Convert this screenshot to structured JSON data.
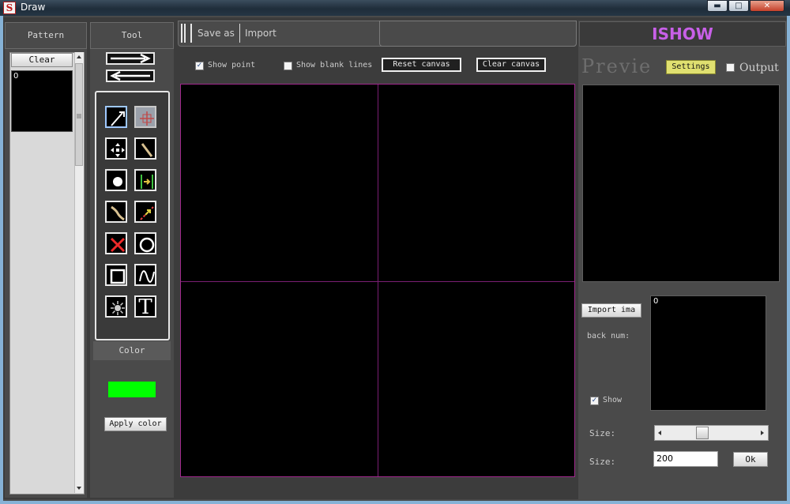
{
  "window": {
    "title": "Draw",
    "app_icon_letter": "S",
    "min_glyph": "▬",
    "max_glyph": "□",
    "close_glyph": "✕"
  },
  "pattern": {
    "header": "Pattern",
    "clear_label": "Clear",
    "items": [
      {
        "index": "0"
      }
    ]
  },
  "tool": {
    "header": "Tool",
    "icons": [
      "pen-icon",
      "select-crosshair-icon",
      "move-icon",
      "line-icon",
      "dot-icon",
      "align-icon",
      "curve-icon",
      "laser-line-icon",
      "delete-icon",
      "circle-icon",
      "rectangle-icon",
      "wave-icon",
      "burst-icon",
      "text-icon"
    ],
    "text_glyph": "T",
    "color_header": "Color",
    "color_value": "#00ff00",
    "apply_color_label": "Apply color"
  },
  "toolbar": {
    "save_as_label": "Save as",
    "import_label": "Import"
  },
  "canvas_options": {
    "show_point_label": "Show point",
    "show_point_checked": true,
    "show_blank_lines_label": "Show blank lines",
    "show_blank_lines_checked": false,
    "reset_canvas_label": "Reset canvas",
    "clear_canvas_label": "Clear canvas"
  },
  "right": {
    "brand": "ISHOW",
    "preview_label": "Previe",
    "settings_label": "Settings",
    "output_label": "Output",
    "output_checked": false,
    "import_image_label": "Import ima",
    "back_num_label": "back num:",
    "import_list_first": "0",
    "show_label": "Show",
    "show_checked": true,
    "size_slider_label": "Size:",
    "size_input_label": "Size:",
    "size_value": "200",
    "ok_label": "Ok",
    "check_glyph": "✓"
  }
}
